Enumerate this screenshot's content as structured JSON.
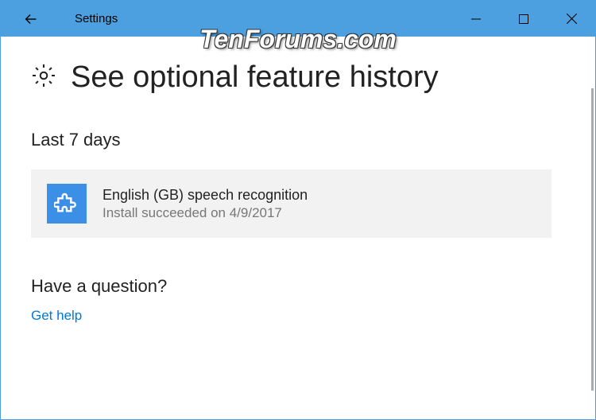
{
  "titlebar": {
    "title": "Settings"
  },
  "page": {
    "title": "See optional feature history"
  },
  "section": {
    "title": "Last 7 days"
  },
  "feature": {
    "name": "English (GB) speech recognition",
    "status": "Install succeeded on 4/9/2017"
  },
  "help": {
    "title": "Have a question?",
    "link": "Get help"
  },
  "watermark": "TenForums.com"
}
